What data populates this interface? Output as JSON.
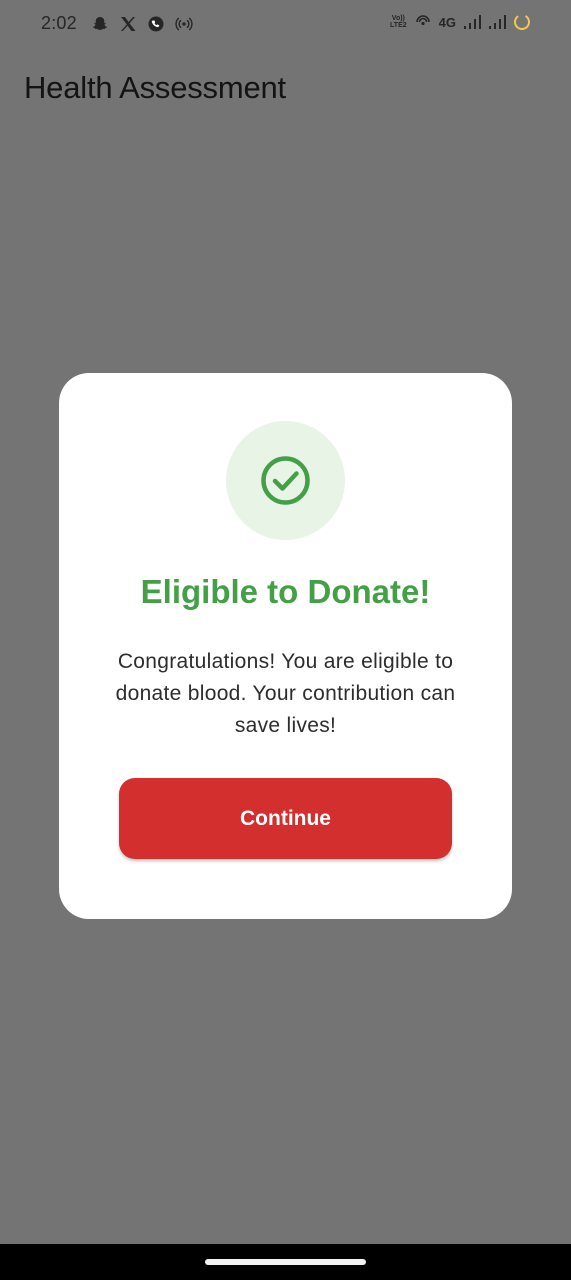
{
  "status_bar": {
    "time": "2:02",
    "left_icons": [
      "snapchat-icon",
      "x-icon",
      "whatsapp-icon",
      "hotspot-icon"
    ],
    "volte_top": "Vo))",
    "volte_bottom": "LTE2",
    "network": "4G",
    "right_icons": [
      "volte-icon",
      "wifi-calling-icon",
      "signal-icon",
      "signal-icon",
      "battery-ring-icon"
    ],
    "battery_color": "#f2c94c"
  },
  "app_bar": {
    "title": "Health Assessment"
  },
  "dialog": {
    "icon": "check-circle-icon",
    "title": "Eligible to Donate!",
    "message": "Congratulations! You are eligible to donate blood. Your contribution can save lives!",
    "continue_label": "Continue",
    "colors": {
      "success": "#43a047",
      "success_bg": "#e7f4e6",
      "button": "#d32f2f"
    }
  }
}
